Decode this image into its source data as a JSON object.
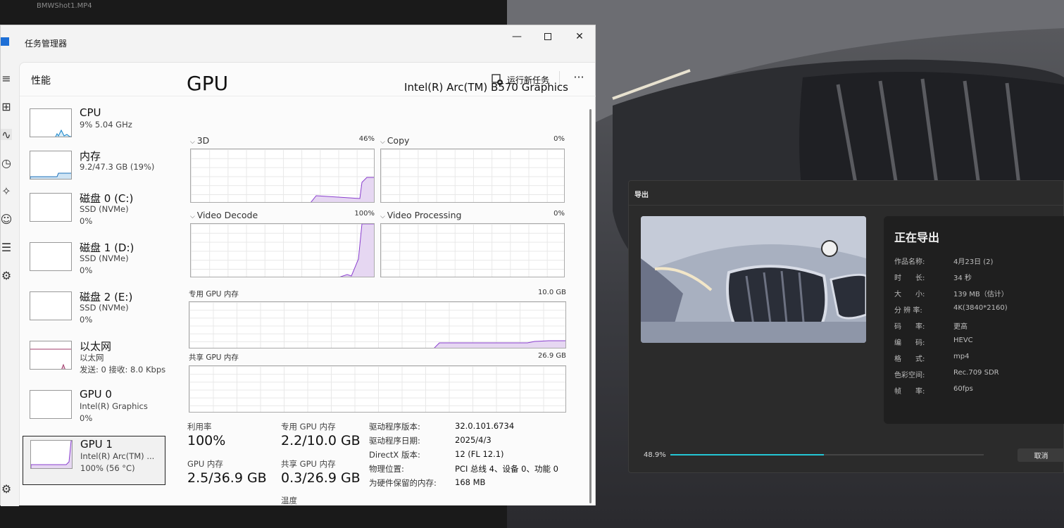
{
  "background": {
    "file_name": "BMWShot1.MP4"
  },
  "task_manager": {
    "title": "任务管理器",
    "page_title": "性能",
    "run_new_task": "运行新任务",
    "devices": [
      {
        "name": "CPU",
        "line1": "9% 5.04 GHz",
        "line2": ""
      },
      {
        "name": "内存",
        "line1": "9.2/47.3 GB (19%)",
        "line2": ""
      },
      {
        "name": "磁盘 0 (C:)",
        "line1": "SSD (NVMe)",
        "line2": "0%"
      },
      {
        "name": "磁盘 1 (D:)",
        "line1": "SSD (NVMe)",
        "line2": "0%"
      },
      {
        "name": "磁盘 2 (E:)",
        "line1": "SSD (NVMe)",
        "line2": "0%"
      },
      {
        "name": "以太网",
        "line1": "以太网",
        "line2": "发送: 0 接收: 8.0 Kbps"
      },
      {
        "name": "GPU 0",
        "line1": "Intel(R) Graphics",
        "line2": "0%"
      },
      {
        "name": "GPU 1",
        "line1": "Intel(R) Arc(TM) ...",
        "line2": "100% (56 °C)"
      }
    ],
    "gpu": {
      "title": "GPU",
      "model": "Intel(R) Arc(TM) B570 Graphics",
      "engines": [
        {
          "label": "3D",
          "pct": "46%",
          "utilization": 0.46
        },
        {
          "label": "Copy",
          "pct": "0%",
          "utilization": 0
        },
        {
          "label": "Video Decode",
          "pct": "100%",
          "utilization": 1.0
        },
        {
          "label": "Video Processing",
          "pct": "0%",
          "utilization": 0
        }
      ],
      "dedicated_label": "专用 GPU 内存",
      "dedicated_max": "10.0 GB",
      "shared_label": "共享 GPU 内存",
      "shared_max": "26.9 GB",
      "stats": {
        "util_label": "利用率",
        "util_value": "100%",
        "dedicated_label": "专用 GPU 内存",
        "dedicated_value": "2.2/10.0 GB",
        "gpu_mem_label": "GPU 内存",
        "gpu_mem_value": "2.5/36.9 GB",
        "shared_label": "共享 GPU 内存",
        "shared_value": "0.3/26.9 GB",
        "temp_label": "温度"
      },
      "details": [
        {
          "k": "驱动程序版本:",
          "v": "32.0.101.6734"
        },
        {
          "k": "驱动程序日期:",
          "v": "2025/4/3"
        },
        {
          "k": "DirectX 版本:",
          "v": "12 (FL 12.1)"
        },
        {
          "k": "物理位置:",
          "v": "PCI 总线 4、设备 0、功能 0"
        },
        {
          "k": "为硬件保留的内存:",
          "v": "168 MB"
        }
      ]
    }
  },
  "export": {
    "title": "导出",
    "heading": "正在导出",
    "info": [
      {
        "k": "作品名称:",
        "v": "4月23日 (2)"
      },
      {
        "k": "时　　长:",
        "v": "34 秒"
      },
      {
        "k": "大　　小:",
        "v": "139 MB（估计）"
      },
      {
        "k": "分 辨 率:",
        "v": "4K(3840*2160)"
      },
      {
        "k": "码　　率:",
        "v": "更高"
      },
      {
        "k": "编　　码:",
        "v": "HEVC"
      },
      {
        "k": "格　　式:",
        "v": "mp4"
      },
      {
        "k": "色彩空间:",
        "v": "Rec.709 SDR"
      },
      {
        "k": "帧　　率:",
        "v": "60fps"
      }
    ],
    "progress_text": "48.9%",
    "progress": 0.489,
    "cancel": "取消",
    "accent": "#24c6d4"
  }
}
